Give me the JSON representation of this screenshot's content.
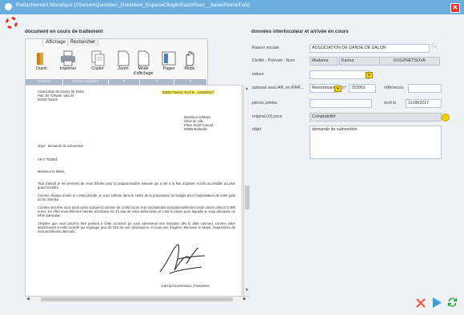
{
  "window": {
    "title": "Rattachement Mosaïque (\\\\Server\\Quotidien_Données\\_EspaceCilogik\\RacciRacc__base\\Pierre\\Faît)"
  },
  "left_panel": {
    "title": "document en cours de traitement",
    "tabs": [
      "Affichage",
      "Rechercher"
    ],
    "ribbon": {
      "buttons": [
        "Ouvrir",
        "Imprimer",
        "Copier",
        "Zoom",
        "Mode\nd'affichage",
        "Pages",
        "Mode"
      ],
      "groups": [
        "Général",
        "Presse-papiers",
        "▾",
        "▾",
        "▾"
      ]
    }
  },
  "document": {
    "sender_lines": [
      "Association de Danse de Salon",
      "Parc de l'Olivaie, villa 34",
      "83200 Toulon"
    ],
    "place_date": "83200 Toulon, Écrit le : 11/08/2017",
    "recipient_lines": [
      "Monsieur le Maire",
      "Hôtel de ville",
      "Place Saint-Conrad",
      "99999 Belleville"
    ],
    "object_line": "objet : demande de subvention",
    "ref_line": "AR n°753951",
    "salutation": "Monsieur le Maire,",
    "paragraphs": [
      "Tout d'abord je me permets de vous féliciter pour la programmation estivale qui a été à la fois originale et très accessible au plus grand nombre.",
      "Comme chaque année en cette période, je vous sollicite dans le cadre de la préparation du budget pour l'organisation de notre gala de fin d'année.",
      "L'année dernière vous nous aviez octroyé la somme de 3 500 euros et je souhaiterais exceptionnellement cette année obtenir 5 000 euros. En effet nous fêterons l'année prochaine les 10 ans de notre association et c'est la raison pour laquelle je vous demande un effort particulier.",
      "J'espère que vous pourrez être présent à cette occasion (je vous adresserai une invitation dès la date connue), comme votre attachement à notre activité qui regroupe plus de 220 de nos concitoyens, et vous prie d'agréer, Monsieur le Maire, l'expression de mes sentiments dévoués."
    ],
    "signature_name": "Karina Kouznetsova, Présidente"
  },
  "right_panel": {
    "title": "données interlocuteur et arrivée en cours",
    "fields": {
      "raison_sociale": {
        "label": "Raison sociale",
        "value": "ASSOCIATION DE DANSE DE SALON"
      },
      "civilite": {
        "label": "Civilité - Prénom - Nom",
        "civ": "Madame",
        "prenom": "Karina",
        "nom": "KOUZNETSOVA"
      },
      "nature": {
        "label": "nature",
        "value": ""
      },
      "adresse": {
        "label": "adressé avec AR, en RAR...",
        "mode": "Recommandé c",
        "num_label": "n°",
        "num": "753951",
        "ref_label": "références",
        "ref": ""
      },
      "pieces": {
        "label": "pièces jointes",
        "value": "",
        "ecrit_label": "écrit le",
        "ecrit": "11/08/2017"
      },
      "original": {
        "label": "original (O) pour",
        "value": "Comptabilité"
      },
      "objet": {
        "label": "objet",
        "value": "demande de subvention"
      }
    }
  },
  "colors": {
    "titlebar": "#6aaee0",
    "accent_yellow": "#f5d000",
    "cancel_red": "#e8513a",
    "play_blue": "#3aa0e0",
    "refresh_green": "#27a040"
  },
  "icons": [
    "lifebuoy-icon",
    "search-icon",
    "calendar-icon",
    "folder-icon",
    "printer-icon",
    "copy-icon",
    "page-icon",
    "pages-icon",
    "hand-icon",
    "cancel-icon",
    "play-icon",
    "refresh-icon"
  ]
}
